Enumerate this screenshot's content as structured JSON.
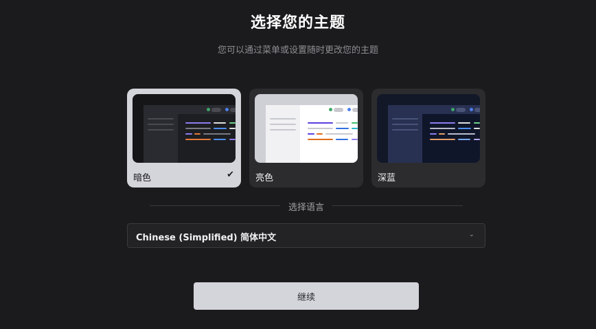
{
  "header": {
    "title": "选择您的主题",
    "subtitle": "您可以通过菜单或设置随时更改您的主题"
  },
  "themes": [
    {
      "label": "暗色",
      "selected": true,
      "check_icon": "check-icon"
    },
    {
      "label": "亮色",
      "selected": false
    },
    {
      "label": "深蓝",
      "selected": false
    }
  ],
  "language": {
    "section_label": "选择语言",
    "selected_value": "Chinese (Simplified) 简体中文",
    "dropdown_icon": "chevron-down-icon"
  },
  "actions": {
    "continue_label": "继续"
  },
  "colors": {
    "background": "#1b1b1d",
    "selected_card": "#d4d5db",
    "card": "#2c2c2f",
    "button": "#d4d5db"
  }
}
